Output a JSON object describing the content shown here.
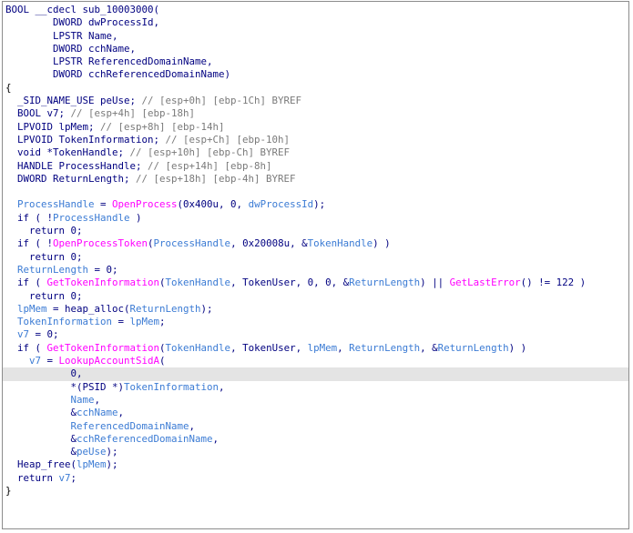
{
  "colors": {
    "default": "#000080",
    "comment": "#7a7a7a",
    "function": "#ff00ff",
    "variable": "#3b7bd4",
    "highlight": "#e4e4e4",
    "border": "#8c8c8c"
  },
  "code": {
    "lines": [
      {
        "highlight": false,
        "tokens": [
          [
            "kw",
            "BOOL __cdecl sub_10003000("
          ]
        ]
      },
      {
        "highlight": false,
        "tokens": [
          [
            "kw",
            "        DWORD dwProcessId,"
          ]
        ]
      },
      {
        "highlight": false,
        "tokens": [
          [
            "kw",
            "        LPSTR Name,"
          ]
        ]
      },
      {
        "highlight": false,
        "tokens": [
          [
            "kw",
            "        DWORD cchName,"
          ]
        ]
      },
      {
        "highlight": false,
        "tokens": [
          [
            "kw",
            "        LPSTR ReferencedDomainName,"
          ]
        ]
      },
      {
        "highlight": false,
        "tokens": [
          [
            "kw",
            "        DWORD cchReferencedDomainName)"
          ]
        ]
      },
      {
        "highlight": false,
        "tokens": [
          [
            "brace",
            "{"
          ]
        ]
      },
      {
        "highlight": false,
        "tokens": [
          [
            "id",
            "  _SID_NAME_USE peUse; "
          ],
          [
            "cmt",
            "// [esp+0h] [ebp-1Ch] BYREF"
          ]
        ]
      },
      {
        "highlight": false,
        "tokens": [
          [
            "id",
            "  BOOL v7; "
          ],
          [
            "cmt",
            "// [esp+4h] [ebp-18h]"
          ]
        ]
      },
      {
        "highlight": false,
        "tokens": [
          [
            "id",
            "  LPVOID lpMem; "
          ],
          [
            "cmt",
            "// [esp+8h] [ebp-14h]"
          ]
        ]
      },
      {
        "highlight": false,
        "tokens": [
          [
            "id",
            "  LPVOID TokenInformation; "
          ],
          [
            "cmt",
            "// [esp+Ch] [ebp-10h]"
          ]
        ]
      },
      {
        "highlight": false,
        "tokens": [
          [
            "id",
            "  void *TokenHandle; "
          ],
          [
            "cmt",
            "// [esp+10h] [ebp-Ch] BYREF"
          ]
        ]
      },
      {
        "highlight": false,
        "tokens": [
          [
            "id",
            "  HANDLE ProcessHandle; "
          ],
          [
            "cmt",
            "// [esp+14h] [ebp-8h]"
          ]
        ]
      },
      {
        "highlight": false,
        "tokens": [
          [
            "id",
            "  DWORD ReturnLength; "
          ],
          [
            "cmt",
            "// [esp+18h] [ebp-4h] BYREF"
          ]
        ]
      },
      {
        "highlight": false,
        "tokens": [
          [
            "id",
            ""
          ]
        ]
      },
      {
        "highlight": false,
        "tokens": [
          [
            "var",
            "  ProcessHandle"
          ],
          [
            "sym",
            " = "
          ],
          [
            "fn",
            "OpenProcess"
          ],
          [
            "sym",
            "(0x400u, 0, "
          ],
          [
            "var",
            "dwProcessId"
          ],
          [
            "sym",
            ");"
          ]
        ]
      },
      {
        "highlight": false,
        "tokens": [
          [
            "sym",
            "  if ( !"
          ],
          [
            "var",
            "ProcessHandle"
          ],
          [
            "sym",
            " )"
          ]
        ]
      },
      {
        "highlight": false,
        "tokens": [
          [
            "sym",
            "    return 0;"
          ]
        ]
      },
      {
        "highlight": false,
        "tokens": [
          [
            "sym",
            "  if ( !"
          ],
          [
            "fn",
            "OpenProcessToken"
          ],
          [
            "sym",
            "("
          ],
          [
            "var",
            "ProcessHandle"
          ],
          [
            "sym",
            ", 0x20008u, &"
          ],
          [
            "var",
            "TokenHandle"
          ],
          [
            "sym",
            ") )"
          ]
        ]
      },
      {
        "highlight": false,
        "tokens": [
          [
            "sym",
            "    return 0;"
          ]
        ]
      },
      {
        "highlight": false,
        "tokens": [
          [
            "var",
            "  ReturnLength"
          ],
          [
            "sym",
            " = 0;"
          ]
        ]
      },
      {
        "highlight": false,
        "tokens": [
          [
            "sym",
            "  if ( "
          ],
          [
            "fn",
            "GetTokenInformation"
          ],
          [
            "sym",
            "("
          ],
          [
            "var",
            "TokenHandle"
          ],
          [
            "sym",
            ", TokenUser, 0, 0, &"
          ],
          [
            "var",
            "ReturnLength"
          ],
          [
            "sym",
            ") || "
          ],
          [
            "fn",
            "GetLastError"
          ],
          [
            "sym",
            "() != 122 )"
          ]
        ]
      },
      {
        "highlight": false,
        "tokens": [
          [
            "sym",
            "    return 0;"
          ]
        ]
      },
      {
        "highlight": false,
        "tokens": [
          [
            "var",
            "  lpMem"
          ],
          [
            "sym",
            " = heap_alloc("
          ],
          [
            "var",
            "ReturnLength"
          ],
          [
            "sym",
            ");"
          ]
        ]
      },
      {
        "highlight": false,
        "tokens": [
          [
            "var",
            "  TokenInformation"
          ],
          [
            "sym",
            " = "
          ],
          [
            "var",
            "lpMem"
          ],
          [
            "sym",
            ";"
          ]
        ]
      },
      {
        "highlight": false,
        "tokens": [
          [
            "var",
            "  v7"
          ],
          [
            "sym",
            " = 0;"
          ]
        ]
      },
      {
        "highlight": false,
        "tokens": [
          [
            "sym",
            "  if ( "
          ],
          [
            "fn",
            "GetTokenInformation"
          ],
          [
            "sym",
            "("
          ],
          [
            "var",
            "TokenHandle"
          ],
          [
            "sym",
            ", TokenUser, "
          ],
          [
            "var",
            "lpMem"
          ],
          [
            "sym",
            ", "
          ],
          [
            "var",
            "ReturnLength"
          ],
          [
            "sym",
            ", &"
          ],
          [
            "var",
            "ReturnLength"
          ],
          [
            "sym",
            ") )"
          ]
        ]
      },
      {
        "highlight": false,
        "tokens": [
          [
            "var",
            "    v7"
          ],
          [
            "sym",
            " = "
          ],
          [
            "fn",
            "LookupAccountSidA"
          ],
          [
            "sym",
            "("
          ]
        ]
      },
      {
        "highlight": true,
        "tokens": [
          [
            "sym",
            "           0,"
          ]
        ]
      },
      {
        "highlight": false,
        "tokens": [
          [
            "sym",
            "           *(PSID *)"
          ],
          [
            "var",
            "TokenInformation"
          ],
          [
            "sym",
            ","
          ]
        ]
      },
      {
        "highlight": false,
        "tokens": [
          [
            "var",
            "           Name"
          ],
          [
            "sym",
            ","
          ]
        ]
      },
      {
        "highlight": false,
        "tokens": [
          [
            "sym",
            "           &"
          ],
          [
            "var",
            "cchName"
          ],
          [
            "sym",
            ","
          ]
        ]
      },
      {
        "highlight": false,
        "tokens": [
          [
            "var",
            "           ReferencedDomainName"
          ],
          [
            "sym",
            ","
          ]
        ]
      },
      {
        "highlight": false,
        "tokens": [
          [
            "sym",
            "           &"
          ],
          [
            "var",
            "cchReferencedDomainName"
          ],
          [
            "sym",
            ","
          ]
        ]
      },
      {
        "highlight": false,
        "tokens": [
          [
            "sym",
            "           &"
          ],
          [
            "var",
            "peUse"
          ],
          [
            "sym",
            ");"
          ]
        ]
      },
      {
        "highlight": false,
        "tokens": [
          [
            "sym",
            "  Heap_free("
          ],
          [
            "var",
            "lpMem"
          ],
          [
            "sym",
            ");"
          ]
        ]
      },
      {
        "highlight": false,
        "tokens": [
          [
            "sym",
            "  return "
          ],
          [
            "var",
            "v7"
          ],
          [
            "sym",
            ";"
          ]
        ]
      },
      {
        "highlight": false,
        "tokens": [
          [
            "brace",
            "}"
          ]
        ]
      }
    ]
  }
}
